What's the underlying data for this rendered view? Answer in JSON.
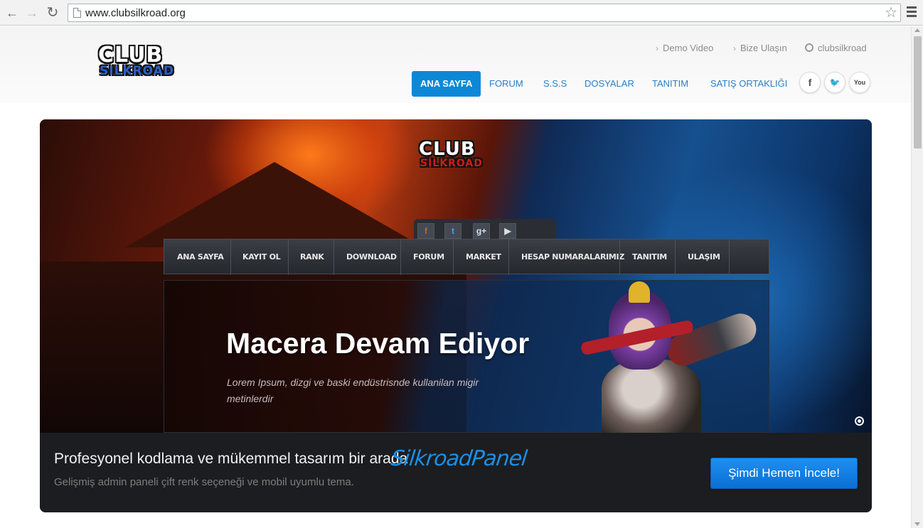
{
  "browser": {
    "url": "www.clubsilkroad.org"
  },
  "header": {
    "logo_top": "CLUB",
    "logo_bottom": "SILKROAD",
    "top_links": [
      {
        "label": "Demo Video"
      },
      {
        "label": "Bize Ulaşın"
      },
      {
        "label": "clubsilkroad"
      }
    ],
    "nav": [
      {
        "label": "ANA SAYFA",
        "active": true
      },
      {
        "label": "FORUM"
      },
      {
        "label": "S.S.S"
      },
      {
        "label": "DOSYALAR"
      },
      {
        "label": "TANITIM"
      },
      {
        "label": "SATIŞ ORTAKLIĞI"
      }
    ],
    "social": [
      {
        "icon": "facebook-icon",
        "glyph": "f"
      },
      {
        "icon": "twitter-icon",
        "glyph": "🐦"
      },
      {
        "icon": "youtube-icon",
        "glyph": "You"
      }
    ]
  },
  "hero": {
    "logo_top": "CLUB",
    "logo_bottom": "SILKROAD",
    "mock_social": [
      {
        "icon": "facebook-icon",
        "glyph": "f"
      },
      {
        "icon": "twitter-icon",
        "glyph": "t"
      },
      {
        "icon": "google-plus-icon",
        "glyph": "g+"
      },
      {
        "icon": "youtube-icon",
        "glyph": "▶"
      }
    ],
    "mock_nav": [
      "ANA SAYFA",
      "KAYIT OL",
      "RANK",
      "DOWNLOAD",
      "FORUM",
      "MARKET",
      "HESAP NUMARALARIMIZ",
      "TANITIM",
      "ULAŞIM"
    ],
    "title": "Macera Devam Ediyor",
    "description": "Lorem Ipsum, dizgi ve baski endüstrisnde kullanilan migir metinlerdir"
  },
  "promo": {
    "text": "Profesyonel kodlama ve mükemmel tasarım bir arada",
    "brand": "SilkroadPanel",
    "subtext": "Gelişmiş admin paneli çift renk seçeneği ve mobil uyumlu tema.",
    "cta": "Şimdi Hemen İncele!"
  },
  "colors": {
    "accent": "#0d88d6",
    "nav_link": "#2a7fc4",
    "cta": "#1a7fe3",
    "brand": "#1a8fe6"
  }
}
